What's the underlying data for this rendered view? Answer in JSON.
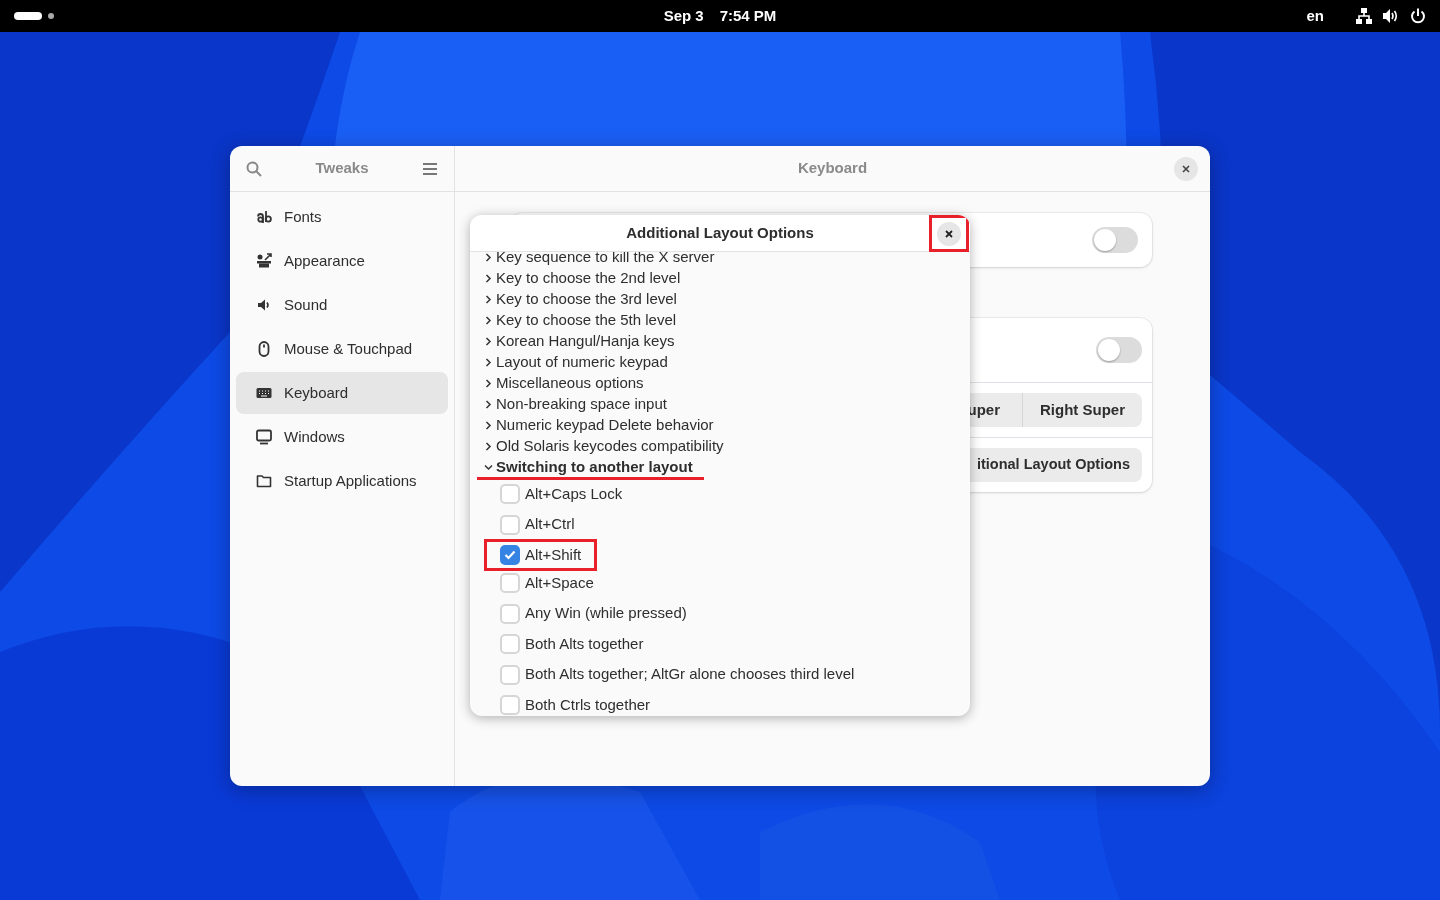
{
  "top_bar": {
    "date": "Sep 3",
    "time": "7:54 PM",
    "input_source": "en"
  },
  "window": {
    "sidebar_title": "Tweaks",
    "title": "Keyboard",
    "sidebar": {
      "items": [
        {
          "label": "Fonts",
          "selected": false
        },
        {
          "label": "Appearance",
          "selected": false
        },
        {
          "label": "Sound",
          "selected": false
        },
        {
          "label": "Mouse & Touchpad",
          "selected": false
        },
        {
          "label": "Keyboard",
          "selected": true
        },
        {
          "label": "Windows",
          "selected": false
        },
        {
          "label": "Startup Applications",
          "selected": false
        }
      ]
    },
    "panel": {
      "switch_1": {
        "on": false
      },
      "switch_2": {
        "on": false
      },
      "segmented": [
        "uper",
        "Right Super"
      ],
      "button": "itional Layout Options"
    }
  },
  "dialog": {
    "title": "Additional Layout Options",
    "close_highlighted": true,
    "groups": [
      {
        "label": "Key sequence to kill the X server",
        "expanded": false,
        "highlighted": false
      },
      {
        "label": "Key to choose the 2nd level",
        "expanded": false,
        "highlighted": false
      },
      {
        "label": "Key to choose the 3rd level",
        "expanded": false,
        "highlighted": false
      },
      {
        "label": "Key to choose the 5th level",
        "expanded": false,
        "highlighted": false
      },
      {
        "label": "Korean Hangul/Hanja keys",
        "expanded": false,
        "highlighted": false
      },
      {
        "label": "Layout of numeric keypad",
        "expanded": false,
        "highlighted": false
      },
      {
        "label": "Miscellaneous options",
        "expanded": false,
        "highlighted": false
      },
      {
        "label": "Non-breaking space input",
        "expanded": false,
        "highlighted": false
      },
      {
        "label": "Numeric keypad Delete behavior",
        "expanded": false,
        "highlighted": false
      },
      {
        "label": "Old Solaris keycodes compatibility",
        "expanded": false,
        "highlighted": false
      },
      {
        "label": "Switching to another layout",
        "expanded": true,
        "highlighted": true,
        "children": [
          {
            "label": "Alt+Caps Lock",
            "checked": false,
            "highlighted": false
          },
          {
            "label": "Alt+Ctrl",
            "checked": false,
            "highlighted": false
          },
          {
            "label": "Alt+Shift",
            "checked": true,
            "highlighted": true
          },
          {
            "label": "Alt+Space",
            "checked": false,
            "highlighted": false
          },
          {
            "label": "Any Win (while pressed)",
            "checked": false,
            "highlighted": false
          },
          {
            "label": "Both Alts together",
            "checked": false,
            "highlighted": false
          },
          {
            "label": "Both Alts together; AltGr alone chooses third level",
            "checked": false,
            "highlighted": false
          },
          {
            "label": "Both Ctrls together",
            "checked": false,
            "highlighted": false
          }
        ]
      }
    ]
  }
}
